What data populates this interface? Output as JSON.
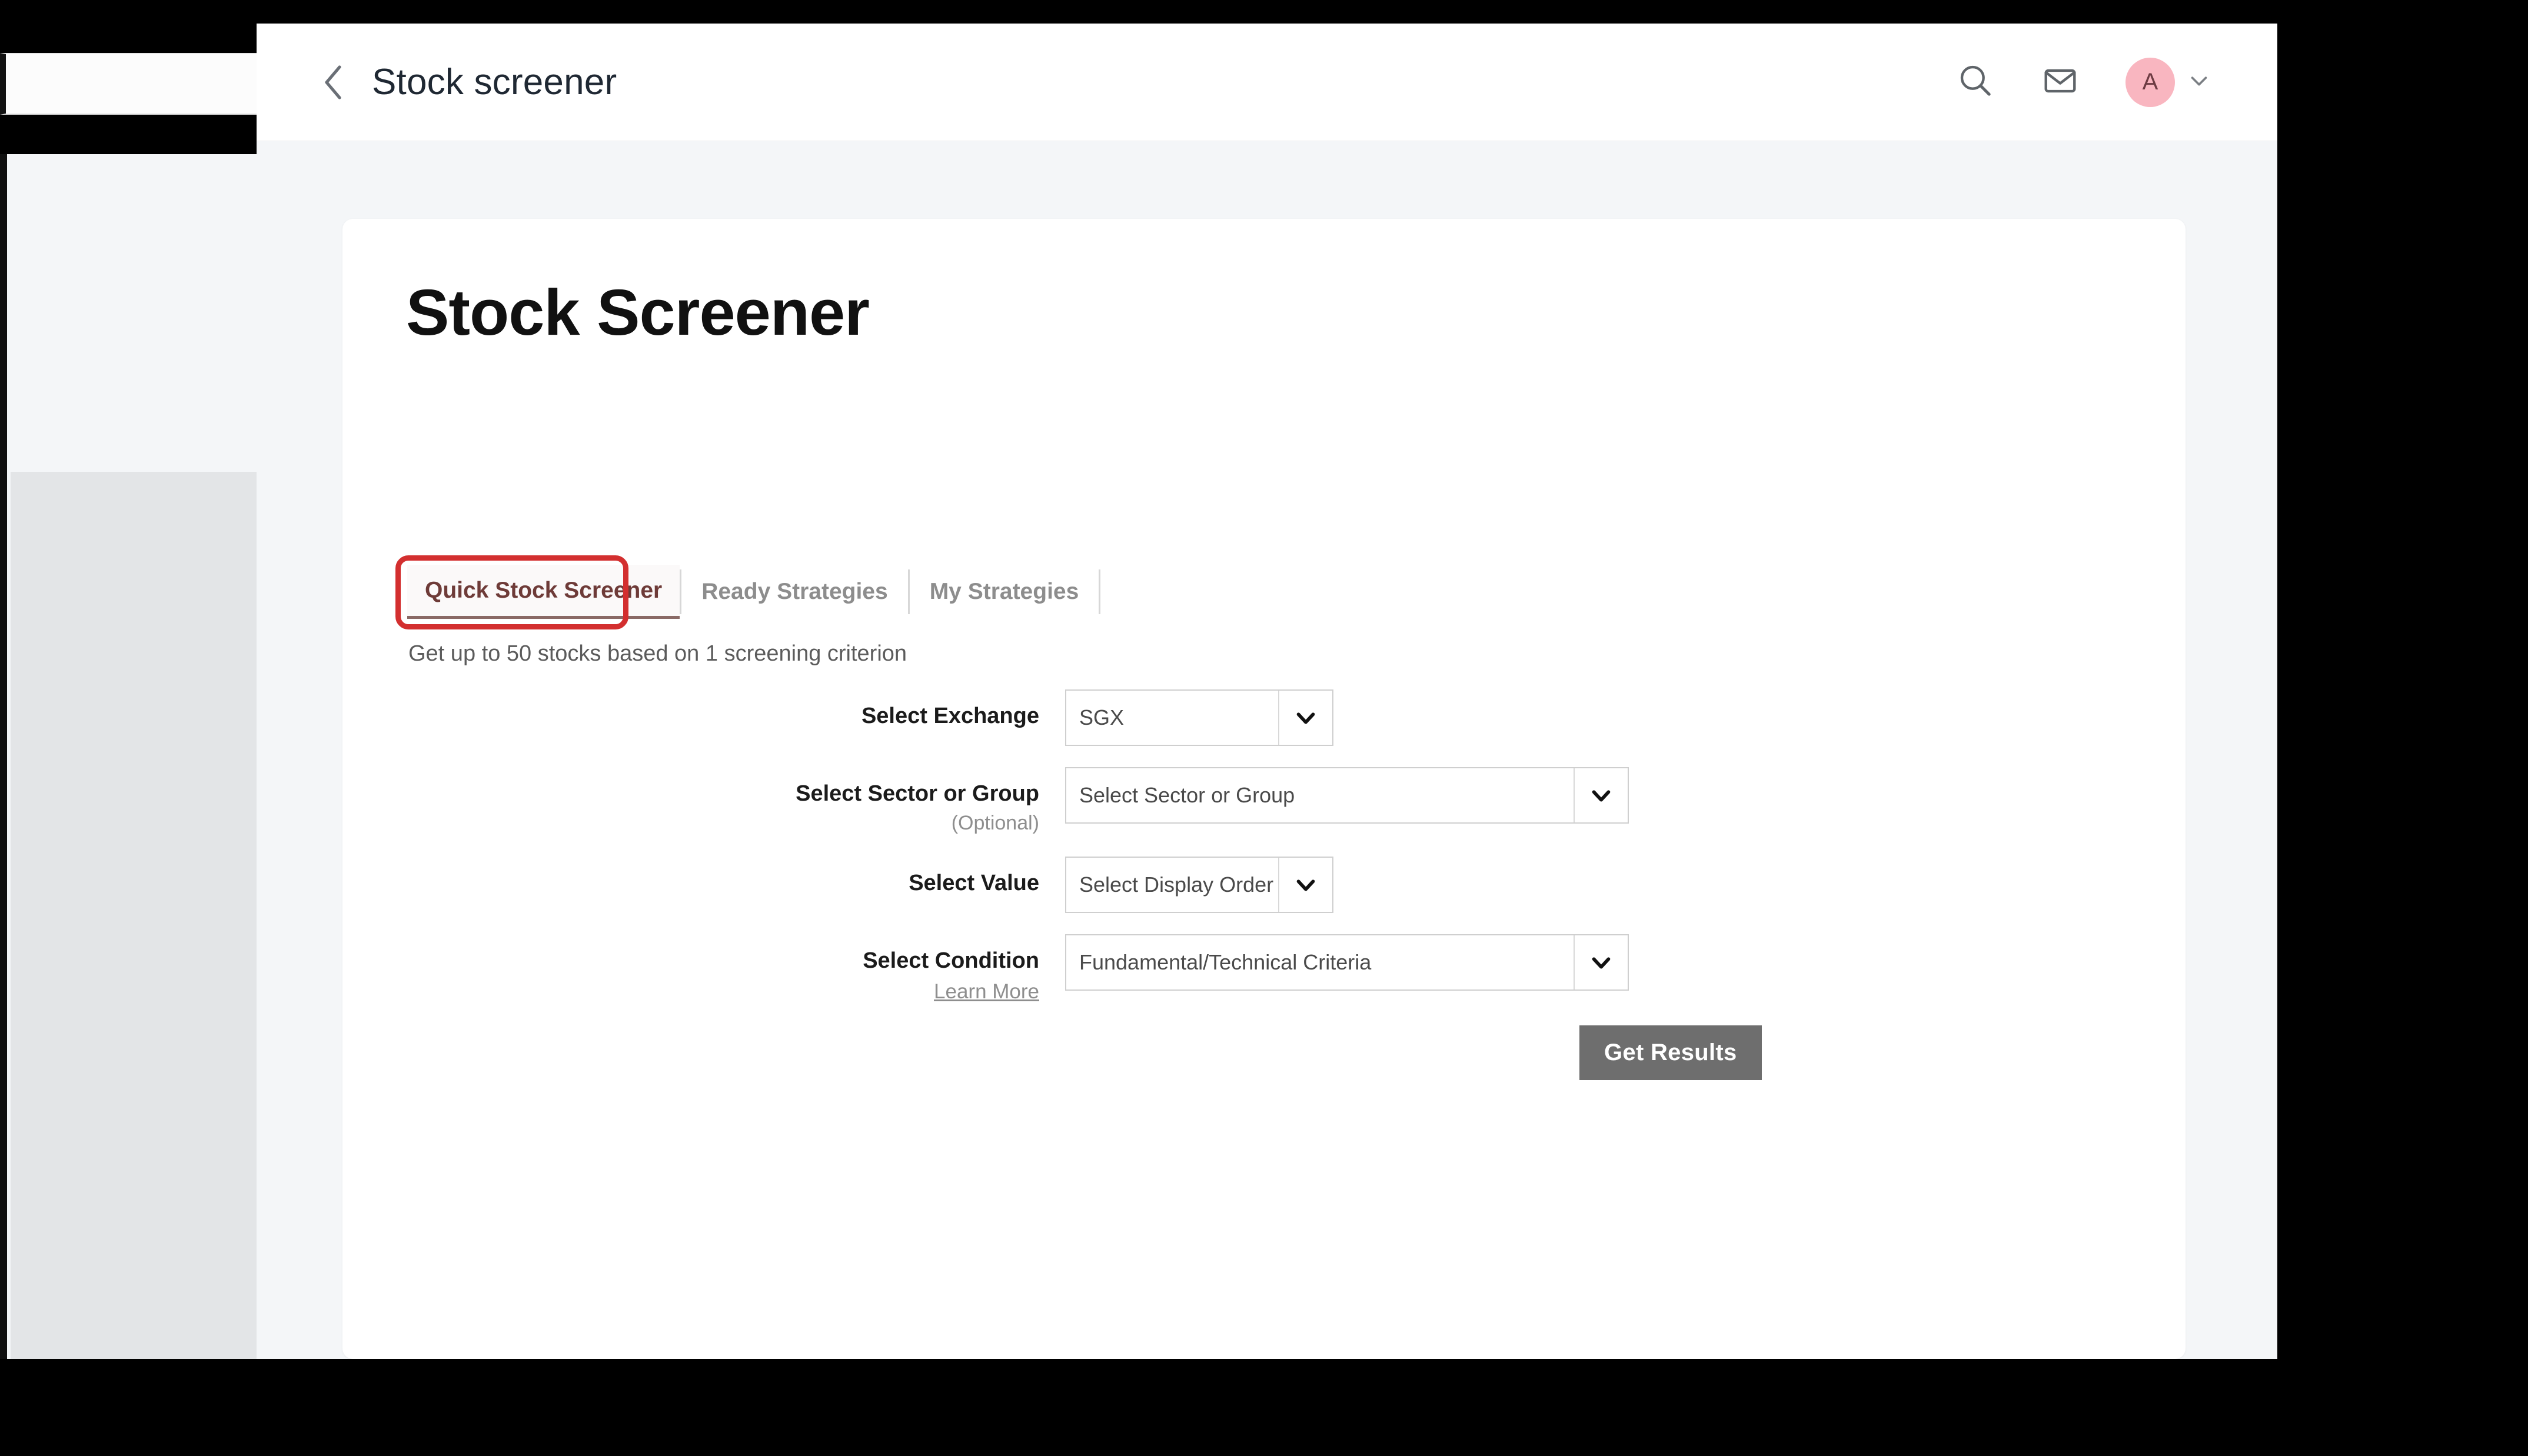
{
  "topbar": {
    "back_icon": "chevron-left-icon",
    "title": "Stock screener",
    "search_icon": "search-icon",
    "mail_icon": "mail-icon",
    "avatar_initial": "A",
    "avatar_chevron_icon": "chevron-down-icon",
    "avatar_bg": "#f9b6c0"
  },
  "page": {
    "title": "Stock Screener",
    "subtitle": "Get up to 50 stocks based on 1 screening criterion"
  },
  "tabs": [
    {
      "label": "Quick Stock Screener",
      "active": true
    },
    {
      "label": "Ready Strategies",
      "active": false
    },
    {
      "label": "My Strategies",
      "active": false
    }
  ],
  "highlight": {
    "target": "Quick Stock Screener",
    "color": "#d32f2f"
  },
  "form": {
    "exchange": {
      "label": "Select Exchange",
      "value": "SGX",
      "arrow_icon": "chevron-down-icon"
    },
    "sector": {
      "label": "Select Sector or Group",
      "optional_note": "(Optional)",
      "value": "Select Sector or Group",
      "arrow_icon": "chevron-down-icon"
    },
    "value": {
      "label": "Select Value",
      "value": "Select Display Order",
      "arrow_icon": "chevron-down-icon"
    },
    "condition": {
      "label": "Select Condition",
      "learn_more": "Learn More",
      "value": "Fundamental/Technical Criteria",
      "arrow_icon": "chevron-down-icon"
    },
    "submit_label": "Get Results",
    "submit_color": "#6e6e6e"
  }
}
